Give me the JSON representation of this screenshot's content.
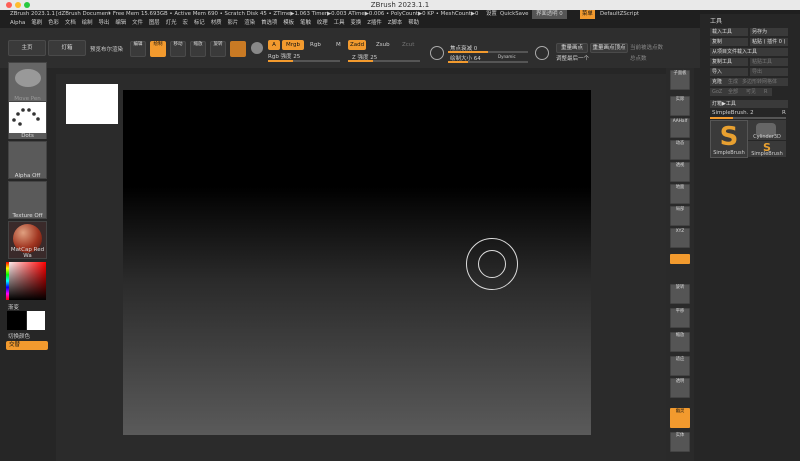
{
  "window": {
    "title": "ZBrush 2023.1.1",
    "traffic": [
      "#fe5f57",
      "#febc2e",
      "#28c840"
    ]
  },
  "status": {
    "app": "ZBrush 2023.1.1",
    "doc": "[dZBrush Document",
    "mem": "• Free Mem 15.693GB • Active Mem 690 • Scratch Disk 45 • ZTime▶1.063 Timer▶0.003 ATime▶0.006 • PolyCount▶0 KP • MeshCount▶0",
    "right": [
      "设置",
      "QuickSave",
      "界面透明 0",
      "菜单",
      "DefaultZScript"
    ]
  },
  "menu": [
    "Alpha",
    "笔刷",
    "色彩",
    "文档",
    "绘制",
    "导出",
    "编辑",
    "文件",
    "图层",
    "灯光",
    "宏",
    "标记",
    "材质",
    "影片",
    "渲染",
    "首选项",
    "模板",
    "笔触",
    "纹理",
    "工具",
    "变换",
    "Z插件",
    "Z脚本",
    "帮助"
  ],
  "toolbar": {
    "home": "主页",
    "lightbox": "灯箱",
    "preview": "预览布尔渲染",
    "tools": [
      "编辑",
      "绘制",
      "移动",
      "缩放",
      "旋转"
    ],
    "a": "A",
    "mrgb": "Mrgb",
    "rgb": "Rgb",
    "m": "M",
    "zadd": "Zadd",
    "zsub": "Zsub",
    "zcut": "Zcut",
    "rgb_intensity": "Rgb 强度 25",
    "z_intensity": "Z 强度 25",
    "focal_shift": "焦点衰减 0",
    "draw_size": "绘制大小 64",
    "dynamic": "Dynamic",
    "vert_weight": "重量画点",
    "vert_weight_tool": "重量画点顶点",
    "adjust_last": "调整最后一个",
    "current_settings": "当前被选点数",
    "total_points": "总点数"
  },
  "left_shelf": {
    "brush": "Move Pen",
    "stroke": "Dots",
    "alpha": "Alpha Off",
    "texture": "Texture Off",
    "material": "MatCap Red Wa",
    "gradient": "渐变",
    "switch_color": "切换颜色",
    "alternate": "交替"
  },
  "right_shelf": [
    "子面板",
    "实际",
    "AAHalf",
    "动态",
    "透视",
    "地面",
    "局部",
    "XYZ",
    "旋转",
    "平移",
    "缩放",
    "适应",
    "透明",
    "幽灵",
    "实体"
  ],
  "tool_panel": {
    "title": "工具",
    "rows": [
      [
        "载入工具",
        "另存为"
      ],
      [
        "复制",
        "粘贴 ( 插件 0 )"
      ],
      [
        "从项目文件载入工具"
      ],
      [
        "复制工具",
        "粘贴工具"
      ],
      [
        "导入",
        "导出"
      ],
      [
        "克隆",
        "生成",
        "多边形转网格体"
      ],
      [
        "GoZ",
        "全部",
        "可见",
        "R"
      ]
    ],
    "lightbox_tools": "灯箱▶工具",
    "current": "SimpleBrush. 2",
    "r": "R",
    "tools": [
      "SimpleBrush",
      "Cylinder3D",
      "SimpleBrush"
    ]
  },
  "colors": {
    "accent": "#f29a2e",
    "bg": "#262626"
  }
}
